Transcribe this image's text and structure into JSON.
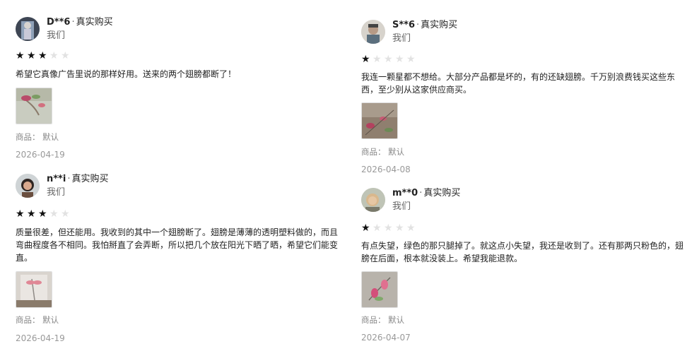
{
  "reviews": [
    {
      "author": "D**6",
      "badge": "真实购买",
      "subtitle": "我们",
      "rating": 3,
      "text": "希望它真像广告里说的那样好用。送来的两个翅膀都断了！",
      "product_label": "商品：",
      "product_value": "默认",
      "date": "2026-04-19"
    },
    {
      "author": "n**i",
      "badge": "真实购买",
      "subtitle": "我们",
      "rating": 3,
      "text": "质量很差，但还能用。我收到的其中一个翅膀断了。翅膀是薄薄的透明塑料做的，而且弯曲程度各不相同。我怕掰直了会弄断，所以把几个放在阳光下晒了晒，希望它们能变直。",
      "product_label": "商品：",
      "product_value": "默认",
      "date": "2026-04-19"
    },
    {
      "author": "S**6",
      "badge": "真实购买",
      "subtitle": "我们",
      "rating": 1,
      "text": "我连一颗星都不想给。大部分产品都是坏的，有的还缺翅膀。千万别浪费钱买这些东西，至少别从这家供应商买。",
      "product_label": "商品：",
      "product_value": "默认",
      "date": "2026-04-08"
    },
    {
      "author": "m**0",
      "badge": "真实购买",
      "subtitle": "我们",
      "rating": 1,
      "text": "有点失望，绿色的那只腿掉了。就这点小失望，我还是收到了。还有那两只粉色的，翅膀在后面，根本就没装上。希望我能退款。",
      "product_label": "商品：",
      "product_value": "默认",
      "date": "2026-04-07"
    }
  ],
  "icons": {
    "star": "star-icon"
  },
  "colors": {
    "star_on": "#111111",
    "star_off": "#e2e2e2"
  }
}
